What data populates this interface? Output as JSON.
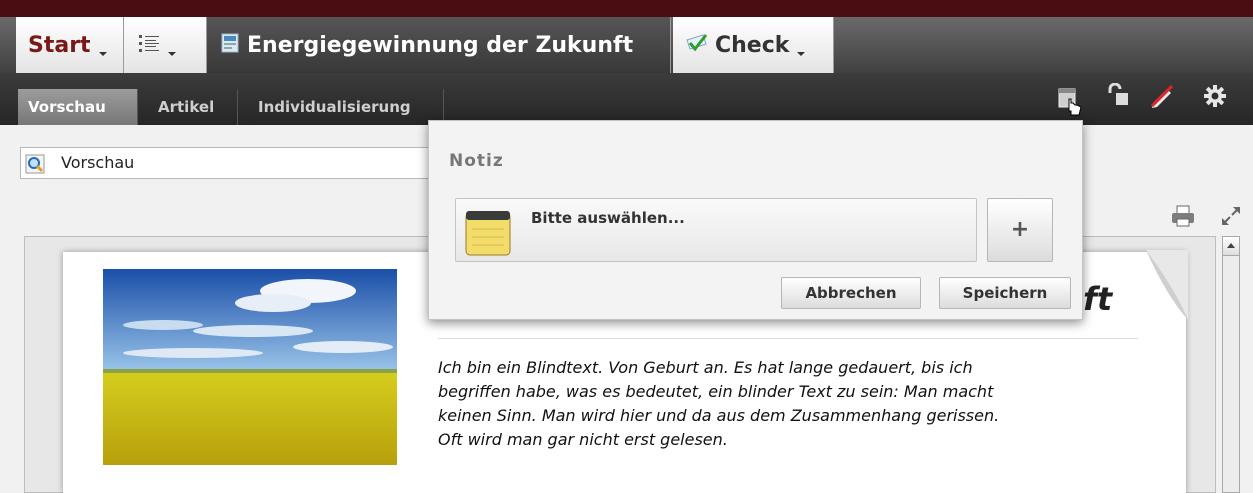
{
  "tabs": {
    "start": "Start",
    "document_title": "Energiegewinnung der Zukunft",
    "check": "Check"
  },
  "subtabs": [
    "Vorschau",
    "Artikel",
    "Individualisierung"
  ],
  "view_select": {
    "value": "Vorschau"
  },
  "popup": {
    "title": "Notiz",
    "select_value": "Bitte auswählen...",
    "add_label": "+",
    "cancel_label": "Abbrechen",
    "save_label": "Speichern"
  },
  "document": {
    "title_fragment": "ft",
    "body_lines": [
      "Ich bin ein Blindtext. Von Geburt an. Es hat lange gedauert, bis ich",
      "begriffen habe, was es bedeutet, ein blinder Text zu sein: Man macht",
      "keinen Sinn. Man wird hier und da aus dem Zusammenhang gerissen.",
      "Oft wird man gar nicht erst gelesen."
    ]
  },
  "colors": {
    "top_strip": "#4a0e12",
    "start_label": "#7a1818",
    "toolbar_dark": "#2e2e2e"
  }
}
